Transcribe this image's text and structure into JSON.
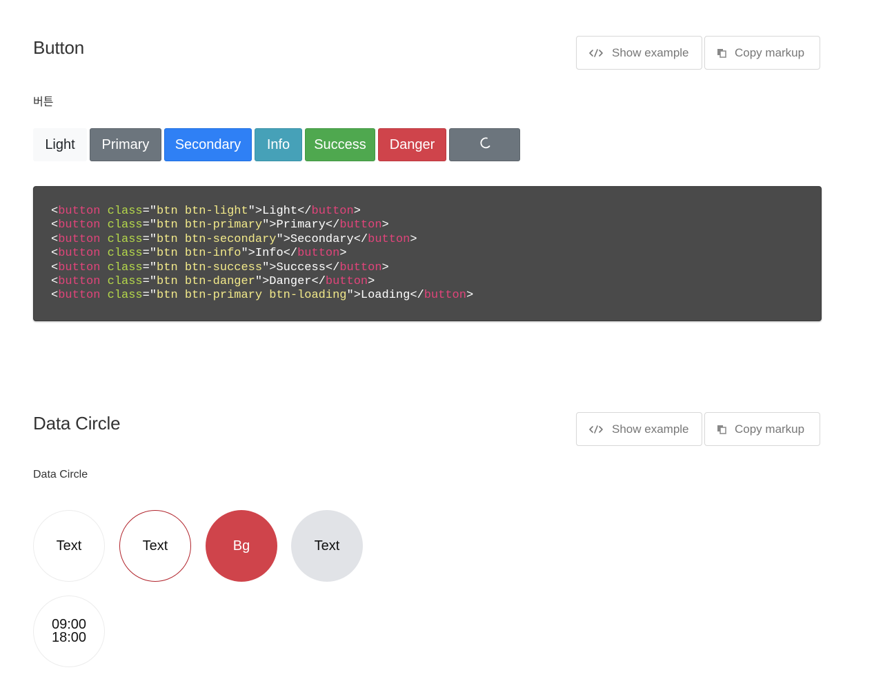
{
  "sections": {
    "button": {
      "title": "Button",
      "description": "버튼",
      "show_example": "Show example",
      "copy_markup": "Copy markup",
      "buttons": [
        "Light",
        "Primary",
        "Secondary",
        "Info",
        "Success",
        "Danger"
      ],
      "code_lines": [
        {
          "cls": "btn btn-light",
          "text": "Light"
        },
        {
          "cls": "btn btn-primary",
          "text": "Primary"
        },
        {
          "cls": "btn btn-secondary",
          "text": "Secondary"
        },
        {
          "cls": "btn btn-info",
          "text": "Info"
        },
        {
          "cls": "btn btn-success",
          "text": "Success"
        },
        {
          "cls": "btn btn-danger",
          "text": "Danger"
        },
        {
          "cls": "btn btn-primary btn-loading",
          "text": "Loading"
        }
      ],
      "code_tag": "button",
      "code_attr": "class"
    },
    "data_circle": {
      "title": "Data Circle",
      "description": "Data Circle",
      "show_example": "Show example",
      "copy_markup": "Copy markup",
      "circles": [
        "Text",
        "Text",
        "Bg",
        "Text"
      ],
      "time_circle": [
        "09:00",
        "18:00"
      ]
    }
  },
  "colors": {
    "light": "#f8f9fa",
    "primary": "#6c757d",
    "secondary": "#2f80f5",
    "info": "#46a1b8",
    "success": "#4fa84f",
    "danger": "#cf444b",
    "code_bg": "#4a4a4a",
    "code_tag": "#e0447a",
    "code_attr": "#b5d84a",
    "code_string": "#f2e98a"
  },
  "icons": {
    "show_example": "code-icon",
    "copy_markup": "copy-icon",
    "loading": "spinner-icon"
  }
}
